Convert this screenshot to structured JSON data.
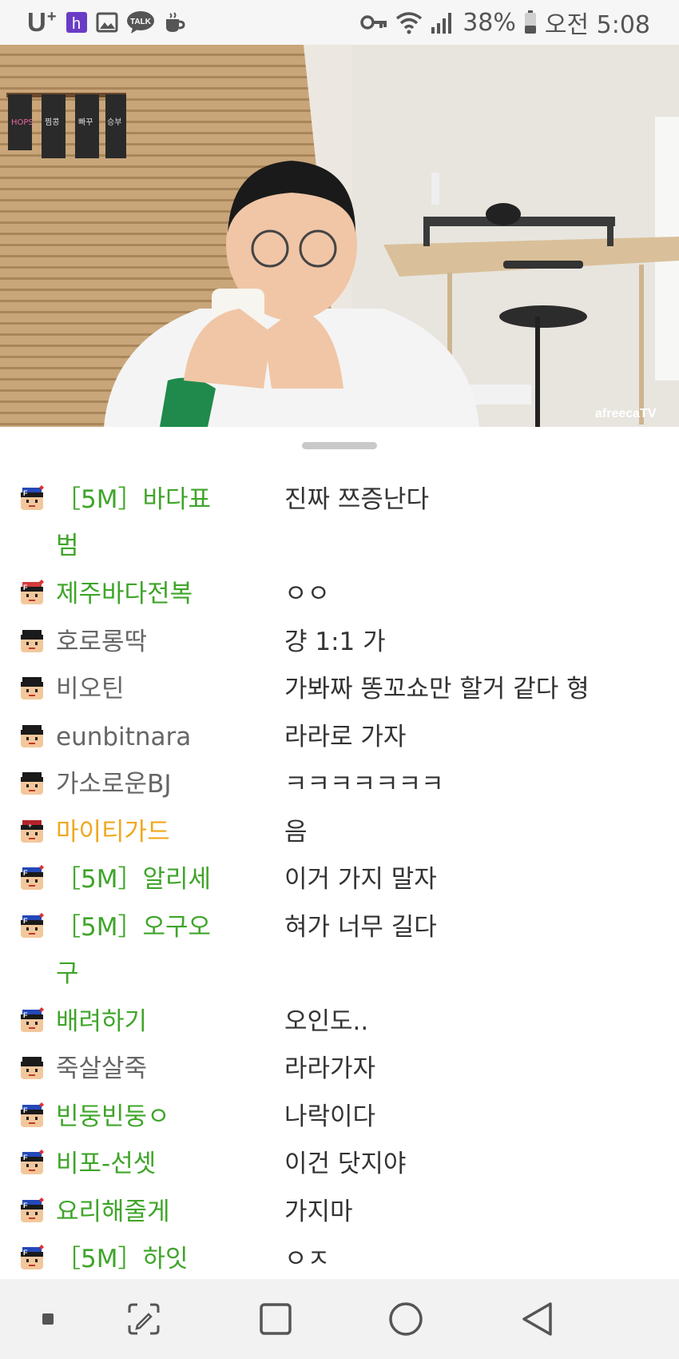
{
  "status_bar": {
    "carrier": "U",
    "carrier_plus": "+",
    "app_icons": [
      "h-app-icon",
      "gallery-icon",
      "kakaotalk-icon",
      "coffee-icon"
    ],
    "talk_label": "TALK",
    "right_icons": [
      "key-icon",
      "wifi-icon",
      "signal-icon"
    ],
    "battery_percent": "38%",
    "time": "오전 5:08"
  },
  "video": {
    "watermark": "afreecaTV",
    "sign_texts": [
      "HOPS",
      "찜콩",
      "빠꾸",
      "승부"
    ]
  },
  "chat": {
    "messages": [
      {
        "nick_line1": "［5M］바다표",
        "nick_line2": "범",
        "text": "진짜 쯔증난다",
        "color": "green",
        "badge": "fan"
      },
      {
        "nick_line1": "제주바다전복",
        "nick_line2": "",
        "text": "ㅇㅇ",
        "color": "green",
        "badge": "fan-red"
      },
      {
        "nick_line1": "호로롱딱",
        "nick_line2": "",
        "text": "걍 1:1 가",
        "color": "gray",
        "badge": "none"
      },
      {
        "nick_line1": "비오틴",
        "nick_line2": "",
        "text": "가봐짜 똥꼬쇼만 할거 같다 형",
        "color": "gray",
        "badge": "none"
      },
      {
        "nick_line1": "eunbitnara",
        "nick_line2": "",
        "text": "라라로 가자",
        "color": "gray",
        "badge": "none"
      },
      {
        "nick_line1": "가소로운BJ",
        "nick_line2": "",
        "text": "ㅋㅋㅋㅋㅋㅋㅋ",
        "color": "gray",
        "badge": "none"
      },
      {
        "nick_line1": "마이티가드",
        "nick_line2": "",
        "text": "음",
        "color": "orange",
        "badge": "manager"
      },
      {
        "nick_line1": "［5M］알리세",
        "nick_line2": "",
        "text": "이거 가지 말자",
        "color": "green",
        "badge": "fan"
      },
      {
        "nick_line1": "［5M］오구오",
        "nick_line2": "구",
        "text": "혀가 너무 길다",
        "color": "green",
        "badge": "fan"
      },
      {
        "nick_line1": "배려하기",
        "nick_line2": "",
        "text": "오인도..",
        "color": "green",
        "badge": "fan"
      },
      {
        "nick_line1": "죽살살죽",
        "nick_line2": "",
        "text": "라라가자",
        "color": "gray",
        "badge": "none"
      },
      {
        "nick_line1": "빈둥빈둥ㅇ",
        "nick_line2": "",
        "text": "나락이다",
        "color": "green",
        "badge": "fan"
      },
      {
        "nick_line1": "비포-선셋",
        "nick_line2": "",
        "text": "이건 닷지야",
        "color": "green",
        "badge": "fan"
      },
      {
        "nick_line1": "요리해줄게",
        "nick_line2": "",
        "text": "가지마",
        "color": "green",
        "badge": "fan"
      },
      {
        "nick_line1": "［5M］하잇",
        "nick_line2": "",
        "text": "ㅇㅈ",
        "color": "green",
        "badge": "fan"
      }
    ]
  },
  "nav_bar": {
    "buttons": [
      "dot-icon",
      "edit-screen-icon",
      "recents-icon",
      "home-icon",
      "back-icon"
    ]
  }
}
